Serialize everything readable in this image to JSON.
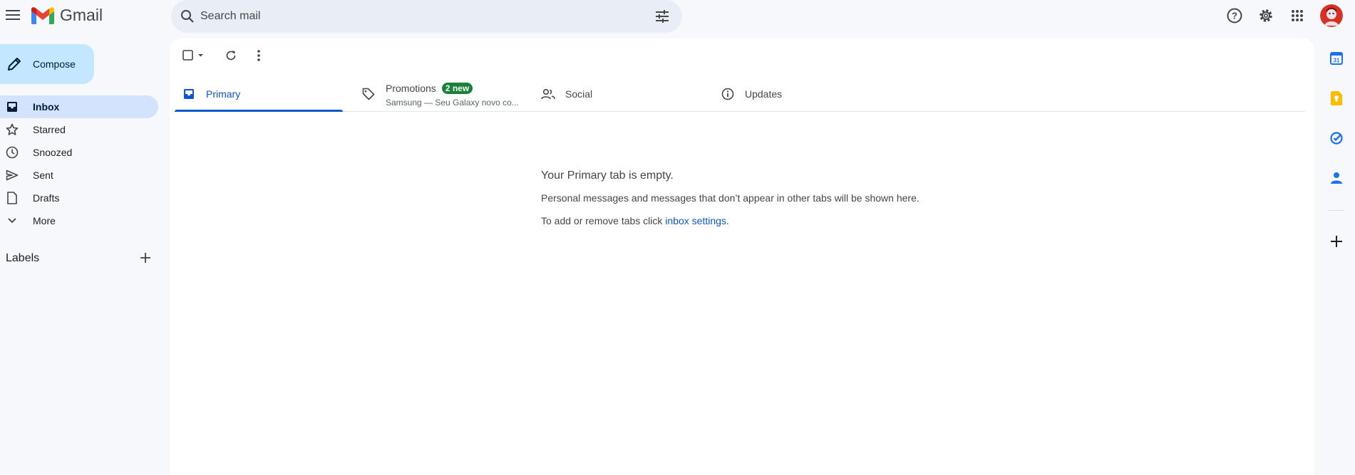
{
  "app": {
    "name": "Gmail"
  },
  "search": {
    "placeholder": "Search mail"
  },
  "compose": {
    "label": "Compose"
  },
  "nav": {
    "items": [
      {
        "label": "Inbox",
        "icon": "inbox-icon",
        "active": true
      },
      {
        "label": "Starred",
        "icon": "star-icon"
      },
      {
        "label": "Snoozed",
        "icon": "clock-icon"
      },
      {
        "label": "Sent",
        "icon": "send-icon"
      },
      {
        "label": "Drafts",
        "icon": "draft-icon"
      },
      {
        "label": "More",
        "icon": "chevron-down-icon"
      }
    ],
    "labels_header": "Labels"
  },
  "tabs": [
    {
      "label": "Primary",
      "icon": "inbox-icon",
      "active": true
    },
    {
      "label": "Promotions",
      "icon": "tag-icon",
      "badge": "2 new",
      "snippet": "Samsung — Seu Galaxy novo co..."
    },
    {
      "label": "Social",
      "icon": "people-icon"
    },
    {
      "label": "Updates",
      "icon": "info-icon"
    }
  ],
  "empty_state": {
    "title": "Your Primary tab is empty.",
    "line1": "Personal messages and messages that don’t appear in other tabs will be shown here.",
    "line2_prefix": "To add or remove tabs click ",
    "line2_link": "inbox settings",
    "line2_suffix": "."
  },
  "colors": {
    "accent": "#0b57d0",
    "compose_bg": "#c2e7ff",
    "active_nav_bg": "#d3e3fd",
    "badge_green": "#188038",
    "page_bg": "#f6f8fc"
  }
}
